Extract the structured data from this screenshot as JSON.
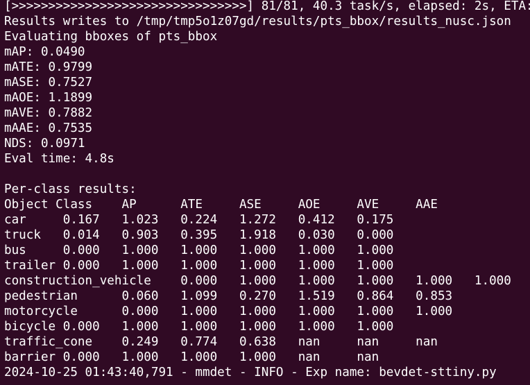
{
  "terminal": {
    "lines": [
      "[>>>>>>>>>>>>>>>>>>>>>>>>>>>>>>>>] 81/81, 40.3 task/s, elapsed: 2s, ETA:",
      "Results writes to /tmp/tmp5o1z07gd/results/pts_bbox/results_nusc.json",
      "Evaluating bboxes of pts_bbox",
      "mAP: 0.0490",
      "mATE: 0.9799",
      "mASE: 0.7527",
      "mAOE: 1.1899",
      "mAVE: 0.7882",
      "mAAE: 0.7535",
      "NDS: 0.0971",
      "Eval time: 4.8s",
      "",
      "Per-class results:",
      "Object Class    AP      ATE     ASE     AOE     AVE     AAE",
      "car     0.167   1.023   0.224   1.272   0.412   0.175",
      "truck   0.014   0.903   0.395   1.918   0.030   0.000",
      "bus     0.000   1.000   1.000   1.000   1.000   1.000",
      "trailer 0.000   1.000   1.000   1.000   1.000   1.000",
      "construction_vehicle    0.000   1.000   1.000   1.000   1.000   1.000",
      "pedestrian      0.060   1.099   0.270   1.519   0.864   0.853",
      "motorcycle      0.000   1.000   1.000   1.000   1.000   1.000",
      "bicycle 0.000   1.000   1.000   1.000   1.000   1.000",
      "traffic_cone    0.249   0.774   0.638   nan     nan     nan",
      "barrier 0.000   1.000   1.000   1.000   nan     nan",
      "2024-10-25 01:43:40,791 - mmdet - INFO - Exp name: bevdet-sttiny.py"
    ]
  }
}
